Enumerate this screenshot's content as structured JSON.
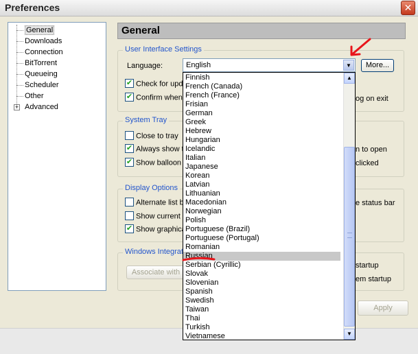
{
  "window": {
    "title": "Preferences",
    "close_glyph": "✕"
  },
  "tree": {
    "items": [
      {
        "label": "General",
        "selected": true
      },
      {
        "label": "Downloads"
      },
      {
        "label": "Connection"
      },
      {
        "label": "BitTorrent"
      },
      {
        "label": "Queueing"
      },
      {
        "label": "Scheduler"
      },
      {
        "label": "Other"
      },
      {
        "label": "Advanced",
        "expandable": true,
        "expander_glyph": "+"
      }
    ]
  },
  "panel": {
    "title": "General"
  },
  "ui_settings": {
    "group_label": "User Interface Settings",
    "language_label": "Language:",
    "language_value": "English",
    "more_button": "More...",
    "check_updates": "Check for upda",
    "confirm_when": "Confirm when",
    "log_on_exit": "og on exit",
    "check_glyph": "✔"
  },
  "system_tray": {
    "group_label": "System Tray",
    "close_to_tray": "Close to tray",
    "always_show": "Always show t",
    "show_balloon": "Show balloon n",
    "right_1": "n to open",
    "right_2": "clicked"
  },
  "display_options": {
    "group_label": "Display Options",
    "alternate_list": "Alternate list b",
    "show_current": "Show current s",
    "show_graphical": "Show graphica",
    "right_1": "e status bar"
  },
  "windows_integration": {
    "group_label": "Windows Integrat",
    "associate_button": "Associate with",
    "right_1": "startup",
    "right_2": "em startup"
  },
  "footer": {
    "apply_button": "Apply"
  },
  "language_dropdown": {
    "options": [
      "Finnish",
      "French (Canada)",
      "French (France)",
      "Frisian",
      "German",
      "Greek",
      "Hebrew",
      "Hungarian",
      "Icelandic",
      "Italian",
      "Japanese",
      "Korean",
      "Latvian",
      "Lithuanian",
      "Macedonian",
      "Norwegian",
      "Polish",
      "Portuguese (Brazil)",
      "Portuguese (Portugal)",
      "Romanian",
      "Russian",
      "Serbian (Cyrillic)",
      "Slovak",
      "Slovenian",
      "Spanish",
      "Swedish",
      "Taiwan",
      "Thai",
      "Turkish",
      "Vietnamese"
    ],
    "highlighted": "Russian",
    "up_glyph": "▲",
    "down_glyph": "▼"
  },
  "colors": {
    "annotation_red": "#e8151b",
    "group_label_blue": "#2255cc"
  },
  "icons": {
    "check": "checkmark-icon",
    "close": "close-icon",
    "arrow": "chevron-down-icon"
  }
}
